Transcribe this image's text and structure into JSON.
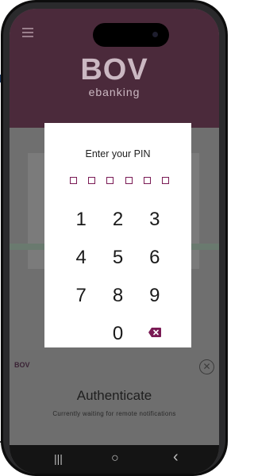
{
  "header": {
    "logo_text": "BOV",
    "sub_text": "ebanking"
  },
  "pin_dialog": {
    "title": "Enter your PIN",
    "keys": [
      "1",
      "2",
      "3",
      "4",
      "5",
      "6",
      "7",
      "8",
      "9",
      "",
      "0"
    ],
    "delete_icon": "backspace-icon",
    "accent_color": "#7a1b55"
  },
  "auth_panel": {
    "logo_text": "BOV",
    "title": "Authenticate",
    "subtitle": "Currently waiting for remote notifications"
  },
  "nav_bar": {
    "recents": "|||",
    "home": "○",
    "back": "‹"
  }
}
